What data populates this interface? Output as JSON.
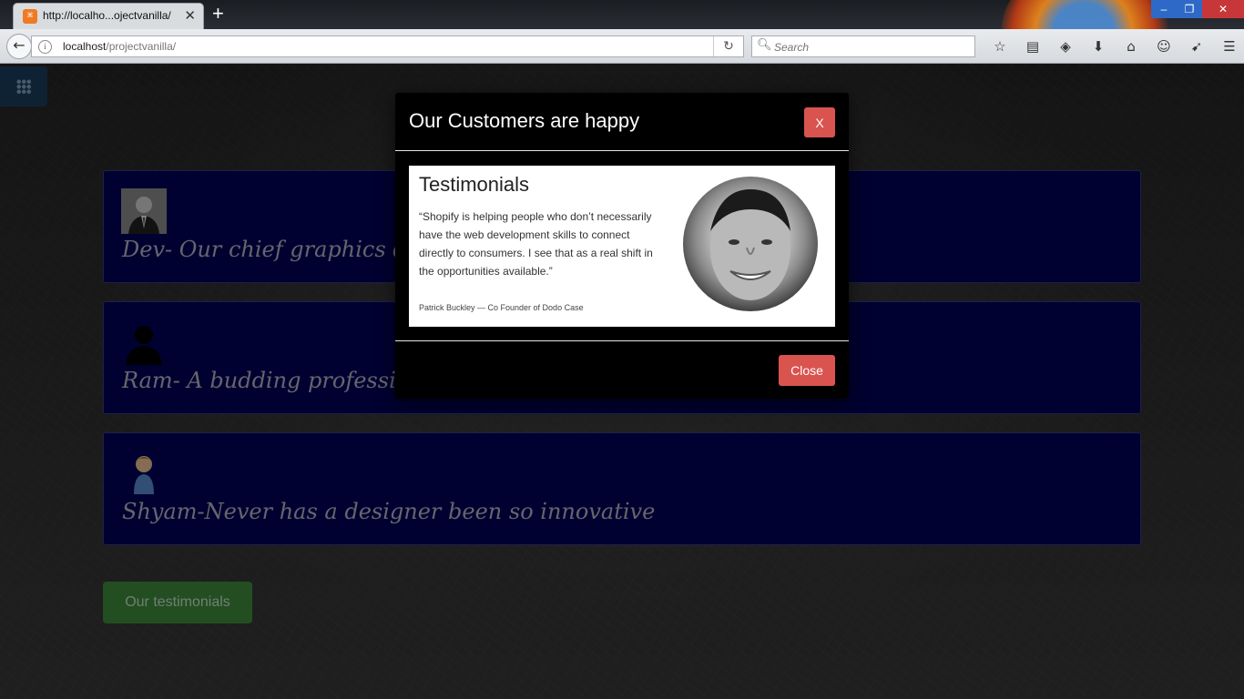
{
  "browser": {
    "tab_title": "http://localho...ojectvanilla/",
    "tab_close": "✕",
    "new_tab": "+",
    "url_host": "localhost",
    "url_path": "/projectvanilla/",
    "search_placeholder": "Search",
    "window_buttons": [
      "–",
      "❐",
      "✕"
    ],
    "toolbar_icons": [
      "star-icon",
      "reading-list-icon",
      "pocket-icon",
      "download-icon",
      "home-icon",
      "smiley-icon",
      "send-icon",
      "menu-icon"
    ]
  },
  "page": {
    "cards": [
      {
        "text": "Dev- Our chief graphics de",
        "icon": "businessman-avatar-icon"
      },
      {
        "text": "Ram- A budding profession",
        "icon": "user-silhouette-icon"
      },
      {
        "text": "Shyam-Never has a designer been so innovative",
        "icon": "person-avatar-icon"
      }
    ],
    "testimonials_button": "Our testimonials"
  },
  "modal": {
    "title": "Our Customers are happy",
    "x_label": "X",
    "heading": "Testimonials",
    "quote": "“Shopify is helping people who don’t necessarily have the web development skills to connect directly to consumers. I see that as a real shift in the opportunities available.”",
    "author": "Patrick Buckley — Co Founder of Dodo Case",
    "close_label": "Close"
  },
  "colors": {
    "card_bg": "#03035a",
    "danger": "#d9534f",
    "success": "#3f8e3f",
    "grid_button": "#1d3e5d"
  }
}
